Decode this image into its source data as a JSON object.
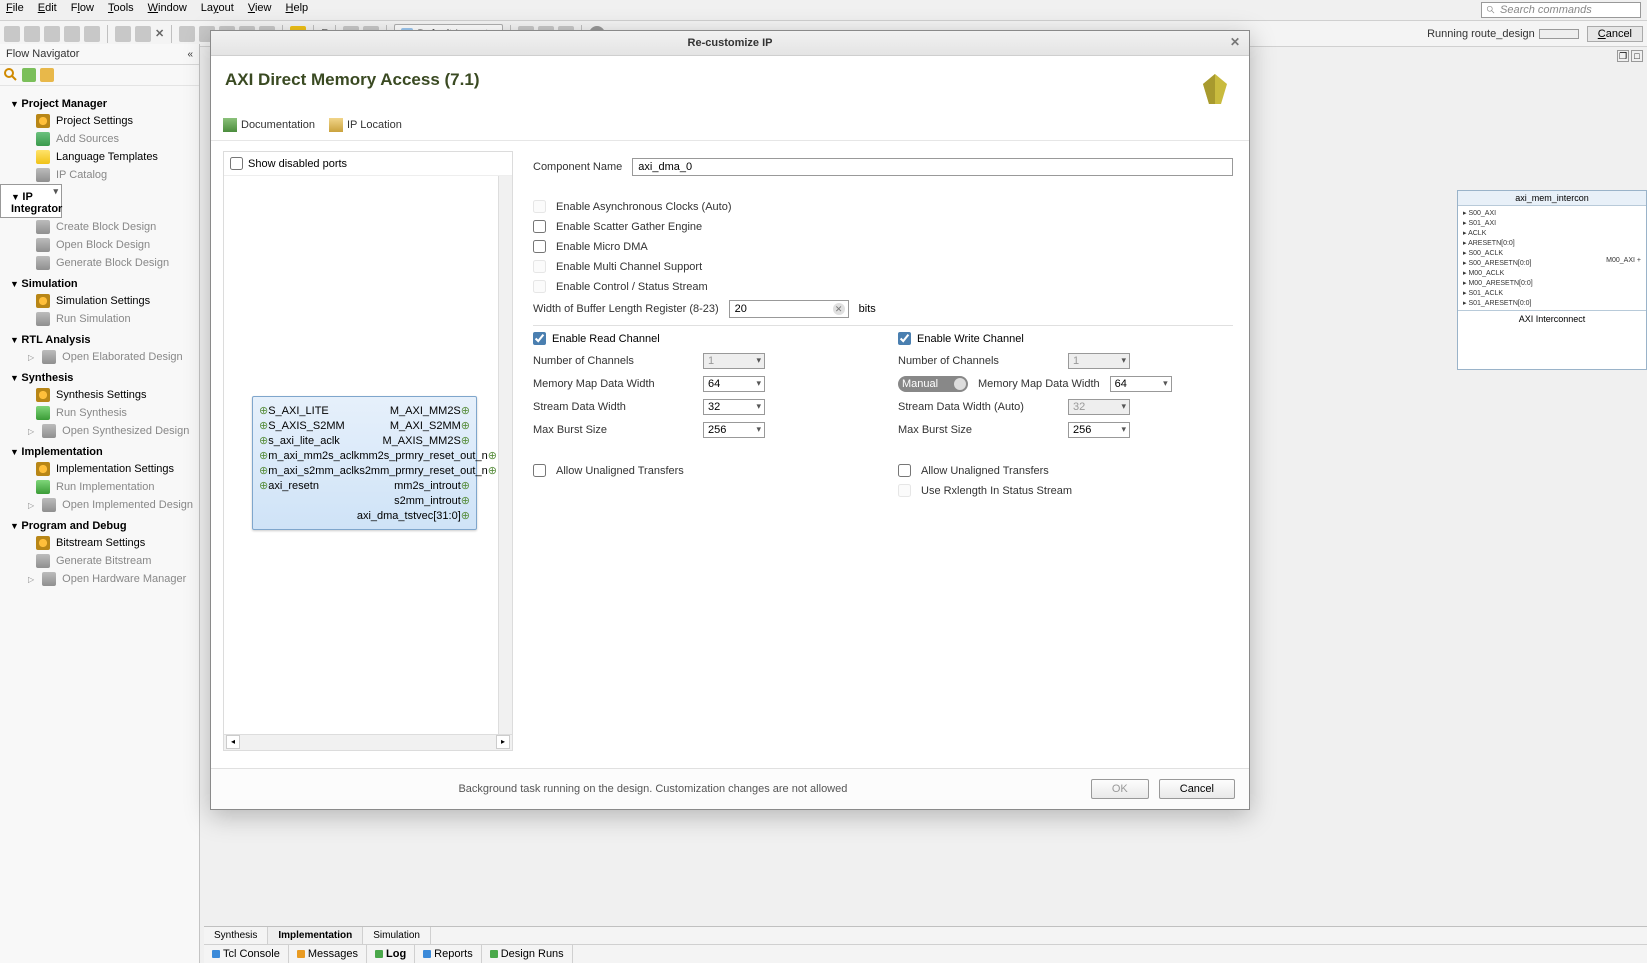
{
  "menubar": [
    "File",
    "Edit",
    "Flow",
    "Tools",
    "Window",
    "Layout",
    "View",
    "Help"
  ],
  "toolbar": {
    "layout_label": "Default Layout",
    "status_running": "Running route_design",
    "cancel": "Cancel",
    "search_placeholder": "Search commands"
  },
  "nav": {
    "title": "Flow Navigator",
    "sections": [
      {
        "label": "Project Manager",
        "items": [
          {
            "label": "Project Settings",
            "ic": "ic-gear",
            "grey": false
          },
          {
            "label": "Add Sources",
            "ic": "ic-add",
            "grey": true
          },
          {
            "label": "Language Templates",
            "ic": "ic-bulb",
            "grey": false
          },
          {
            "label": "IP Catalog",
            "ic": "ic-book",
            "grey": true
          }
        ]
      },
      {
        "label": "IP Integrator",
        "selected": true,
        "items": [
          {
            "label": "Create Block Design",
            "ic": "ic-block",
            "grey": true
          },
          {
            "label": "Open Block Design",
            "ic": "ic-block",
            "grey": true
          },
          {
            "label": "Generate Block Design",
            "ic": "ic-block",
            "grey": true
          }
        ]
      },
      {
        "label": "Simulation",
        "items": [
          {
            "label": "Simulation Settings",
            "ic": "ic-gear",
            "grey": false
          },
          {
            "label": "Run Simulation",
            "ic": "ic-block",
            "grey": true
          }
        ]
      },
      {
        "label": "RTL Analysis",
        "items": [
          {
            "label": "Open Elaborated Design",
            "ic": "ic-block",
            "grey": true,
            "sub": true
          }
        ]
      },
      {
        "label": "Synthesis",
        "items": [
          {
            "label": "Synthesis Settings",
            "ic": "ic-gear",
            "grey": false
          },
          {
            "label": "Run Synthesis",
            "ic": "ic-play",
            "grey": true
          },
          {
            "label": "Open Synthesized Design",
            "ic": "ic-block",
            "grey": true,
            "sub": true
          }
        ]
      },
      {
        "label": "Implementation",
        "items": [
          {
            "label": "Implementation Settings",
            "ic": "ic-gear",
            "grey": false
          },
          {
            "label": "Run Implementation",
            "ic": "ic-play",
            "grey": true
          },
          {
            "label": "Open Implemented Design",
            "ic": "ic-block",
            "grey": true,
            "sub": true
          }
        ]
      },
      {
        "label": "Program and Debug",
        "items": [
          {
            "label": "Bitstream Settings",
            "ic": "ic-gear",
            "grey": false
          },
          {
            "label": "Generate Bitstream",
            "ic": "ic-block",
            "grey": true
          },
          {
            "label": "Open Hardware Manager",
            "ic": "ic-block",
            "grey": true,
            "sub": true
          }
        ]
      }
    ]
  },
  "bottom_tabs": {
    "row1": [
      "Synthesis",
      "Implementation",
      "Simulation"
    ],
    "row1_active": 1,
    "row2": [
      {
        "label": "Tcl Console",
        "color": "#3b8ad9"
      },
      {
        "label": "Messages",
        "color": "#e99b22"
      },
      {
        "label": "Log",
        "color": "#4aa84a",
        "active": true
      },
      {
        "label": "Reports",
        "color": "#3b8ad9"
      },
      {
        "label": "Design Runs",
        "color": "#4aa84a"
      }
    ]
  },
  "bd_slice": {
    "title": "axi_mem_intercon",
    "ports": [
      "S00_AXI",
      "S01_AXI",
      "ACLK",
      "ARESETN[0:0]",
      "S00_ACLK",
      "S00_ARESETN[0:0]",
      "M00_ACLK",
      "M00_ARESETN[0:0]",
      "S01_ACLK",
      "S01_ARESETN[0:0]"
    ],
    "out_port": "M00_AXI",
    "footer": "AXI Interconnect"
  },
  "dialog": {
    "titlebar": "Re-customize IP",
    "header": "AXI Direct Memory Access (7.1)",
    "links": {
      "doc": "Documentation",
      "iploc": "IP Location"
    },
    "left": {
      "show_disabled": "Show disabled ports",
      "ip_ports_left": [
        "S_AXI_LITE",
        "S_AXIS_S2MM",
        "s_axi_lite_aclk",
        "m_axi_mm2s_aclk",
        "m_axi_s2mm_aclk",
        "axi_resetn"
      ],
      "ip_ports_right": [
        "M_AXI_MM2S",
        "M_AXI_S2MM",
        "M_AXIS_MM2S",
        "mm2s_prmry_reset_out_n",
        "s2mm_prmry_reset_out_n",
        "mm2s_introut",
        "s2mm_introut",
        "axi_dma_tstvec[31:0]"
      ]
    },
    "form": {
      "comp_name_label": "Component Name",
      "comp_name_value": "axi_dma_0",
      "cb_async": "Enable Asynchronous Clocks (Auto)",
      "cb_sg": "Enable Scatter Gather Engine",
      "cb_micro": "Enable Micro DMA",
      "cb_multi": "Enable Multi Channel Support",
      "cb_ctrl": "Enable Control / Status Stream",
      "buflen_label": "Width of Buffer Length Register (8-23)",
      "buflen_value": "20",
      "buflen_unit": "bits",
      "read": {
        "enable": "Enable Read Channel",
        "numch_label": "Number of Channels",
        "numch": "1",
        "mmw_label": "Memory Map Data Width",
        "mmw": "64",
        "sdw_label": "Stream Data Width",
        "sdw": "32",
        "burst_label": "Max Burst Size",
        "burst": "256",
        "unaligned": "Allow Unaligned Transfers"
      },
      "write": {
        "enable": "Enable Write Channel",
        "numch_label": "Number of Channels",
        "numch": "1",
        "manual": "Manual",
        "mmw_label": "Memory Map Data Width",
        "mmw": "64",
        "sdw_label": "Stream Data Width (Auto)",
        "sdw": "32",
        "burst_label": "Max Burst Size",
        "burst": "256",
        "unaligned": "Allow Unaligned Transfers",
        "rxlen": "Use Rxlength In Status Stream"
      }
    },
    "footer": {
      "msg": "Background task running on the design. Customization changes are not allowed",
      "ok": "OK",
      "cancel": "Cancel"
    }
  }
}
